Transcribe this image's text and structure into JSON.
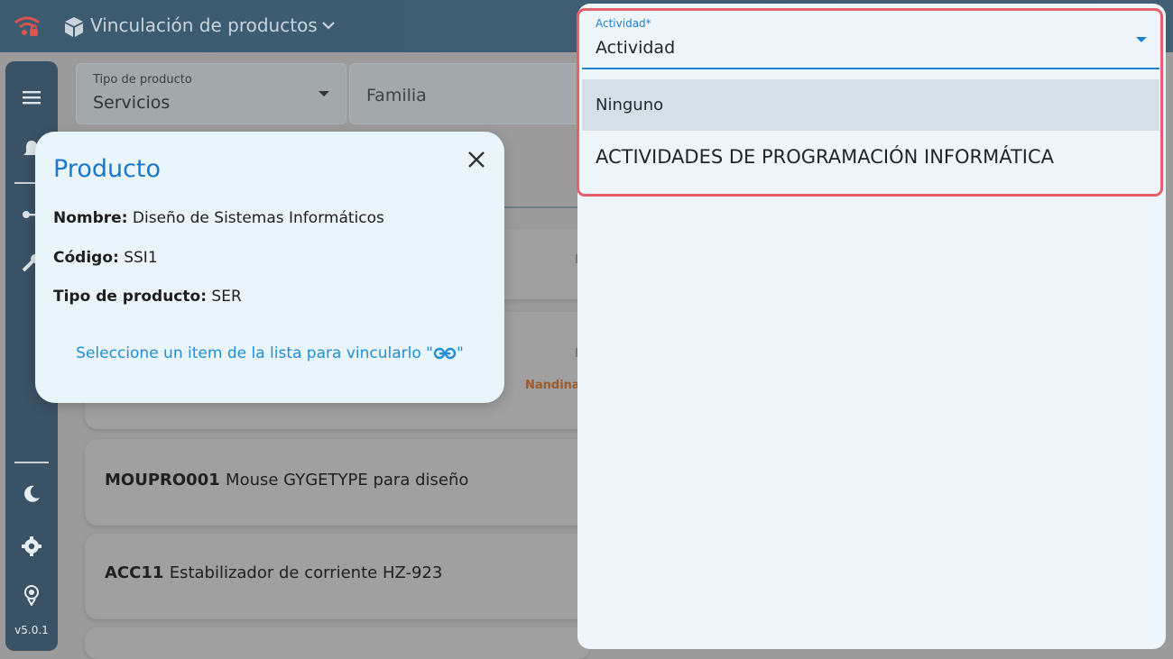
{
  "header": {
    "title": "Vinculación de productos"
  },
  "sidebar": {
    "version": "v5.0.1"
  },
  "filters": {
    "tipo_label": "Tipo de producto",
    "tipo_value": "Servicios",
    "familia_placeholder": "Familia"
  },
  "list": {
    "items": [
      {
        "code": "MOUPRO001",
        "name": "Mouse GYGETYPE para diseño"
      },
      {
        "code": "ACC11",
        "name": "Estabilizador de corriente HZ-923"
      }
    ],
    "tag": "Nandina"
  },
  "popup": {
    "title": "Producto",
    "nombre_label": "Nombre:",
    "nombre_value": "Diseño de Sistemas Informáticos",
    "codigo_label": "Código:",
    "codigo_value": "SSI1",
    "tipo_label": "Tipo de producto:",
    "tipo_value": "SER",
    "hint_before": "Seleccione un item de la lista para vincularlo \"",
    "hint_after": "\""
  },
  "dropdown": {
    "label": "Actividad*",
    "value": "Actividad",
    "options": [
      "Ninguno",
      "ACTIVIDADES DE PROGRAMACIÓN INFORMÁTICA"
    ]
  },
  "colors": {
    "accent": "#1f7fd2",
    "highlight_border": "#e6606a",
    "popup_bg": "#eaf4fb"
  }
}
